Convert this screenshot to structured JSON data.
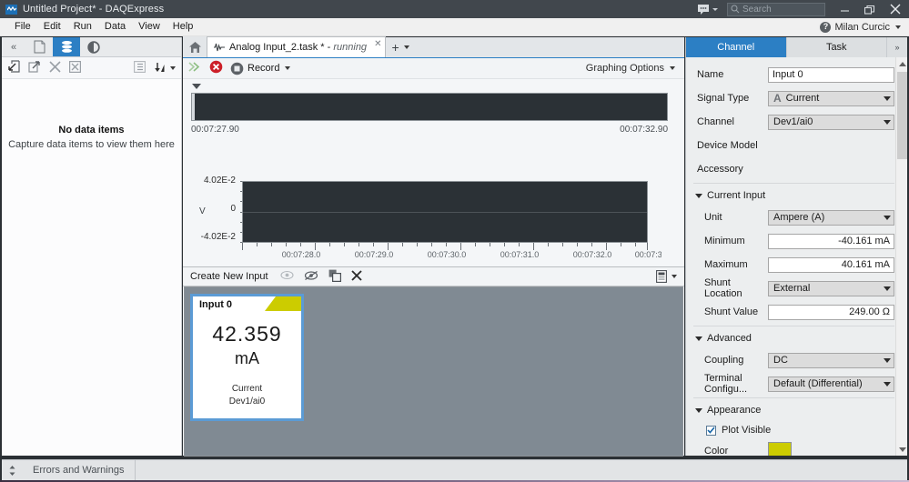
{
  "window": {
    "title": "Untitled Project* - DAQExpress",
    "logo_icon": "waveform-logo-icon",
    "chat_icon": "feedback-chat-icon",
    "minimize_icon": "minimize-icon",
    "maximize_icon": "restore-icon",
    "close_icon": "close-icon"
  },
  "search": {
    "placeholder": "Search",
    "icon": "search-icon"
  },
  "menu": {
    "items": [
      "File",
      "Edit",
      "Run",
      "Data",
      "View",
      "Help"
    ],
    "help_icon": "help-question-icon",
    "user": "Milan Curcic"
  },
  "left_panel": {
    "collapse_icon": "collapse-left-icon",
    "tabs": [
      {
        "name": "project-tab",
        "icon": "document-icon",
        "selected": false
      },
      {
        "name": "data-tab",
        "icon": "database-stack-icon",
        "selected": true
      },
      {
        "name": "device-tab",
        "icon": "circle-dot-icon",
        "selected": false
      }
    ],
    "toolbar": [
      {
        "name": "import-button",
        "icon": "import-arrow-icon"
      },
      {
        "name": "export-button",
        "icon": "export-arrow-icon"
      },
      {
        "name": "delete-button",
        "icon": "x-icon"
      },
      {
        "name": "delete-all-button",
        "icon": "x-box-icon"
      },
      {
        "name": "list-view-button",
        "icon": "list-icon"
      },
      {
        "name": "sort-button",
        "icon": "sort-down-icon"
      }
    ],
    "empty_title": "No data items",
    "empty_subtitle": "Capture data items to view them here"
  },
  "center": {
    "home_tab_icon": "home-icon",
    "document_tab": {
      "icon": "waveform-icon",
      "label": "Analog Input_2.task * - ",
      "status": "running",
      "close_icon": "close-icon"
    },
    "new_tab_label": "+",
    "toolbar": {
      "run_icon": "run-arrows-icon",
      "stop_icon": "stop-error-icon",
      "record_icon": "record-icon",
      "record_label": "Record"
    },
    "graphing_options_label": "Graphing Options",
    "graph": {
      "scrub_start": "00:07:27.90",
      "scrub_end": "00:07:32.90",
      "y_axis_title": "V",
      "y_ticks": [
        "4.02E-2",
        "0",
        "-4.02E-2"
      ]
    },
    "input_toolbar": {
      "create_label": "Create New Input",
      "show_icon": "eye-icon",
      "hide_icon": "eye-slash-icon",
      "duplicate_icon": "duplicate-icon",
      "delete_icon": "x-icon",
      "panel_icon": "panel-layout-icon"
    },
    "card": {
      "name": "Input 0",
      "value": "42.359",
      "unit": "mA",
      "signal": "Current",
      "channel": "Dev1/ai0",
      "corner_color": "#cccc00",
      "border_color": "#5b9bd5"
    }
  },
  "right_panel": {
    "tabs": [
      {
        "label": "Channel",
        "selected": true
      },
      {
        "label": "Task",
        "selected": false
      }
    ],
    "expand_icon": "expand-right-icon",
    "fields": {
      "name_label": "Name",
      "name_value": "Input 0",
      "signal_type_label": "Signal Type",
      "signal_type_value": "Current",
      "signal_type_icon": "A",
      "channel_label": "Channel",
      "channel_value": "Dev1/ai0",
      "device_model_label": "Device Model",
      "device_model_value": "",
      "accessory_label": "Accessory",
      "accessory_value": ""
    },
    "current_input": {
      "section_label": "Current Input",
      "unit_label": "Unit",
      "unit_value": "Ampere (A)",
      "minimum_label": "Minimum",
      "minimum_value": "-40.161 mA",
      "maximum_label": "Maximum",
      "maximum_value": "40.161 mA",
      "shunt_location_label": "Shunt Location",
      "shunt_location_value": "External",
      "shunt_value_label": "Shunt Value",
      "shunt_value_value": "249.00 Ω"
    },
    "advanced": {
      "section_label": "Advanced",
      "coupling_label": "Coupling",
      "coupling_value": "DC",
      "terminal_label": "Terminal Configu...",
      "terminal_value": "Default (Differential)"
    },
    "appearance": {
      "section_label": "Appearance",
      "plot_visible_label": "Plot Visible",
      "plot_visible_checked": true,
      "color_label": "Color",
      "color_value": "#cccc00"
    }
  },
  "status_bar": {
    "expand_icon": "expand-up-down-icon",
    "errors_label": "Errors and Warnings"
  }
}
